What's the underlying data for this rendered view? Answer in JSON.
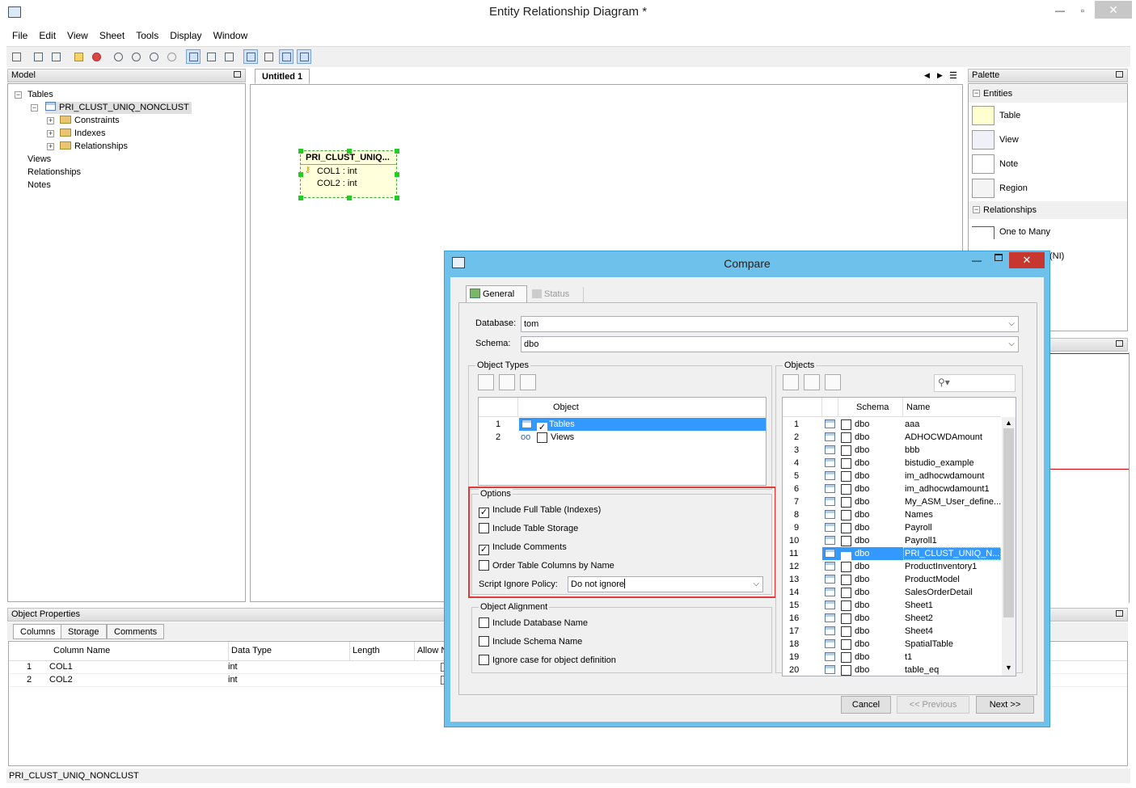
{
  "app": {
    "title": "Entity Relationship Diagram *"
  },
  "menu": [
    "File",
    "Edit",
    "View",
    "Sheet",
    "Tools",
    "Display",
    "Window"
  ],
  "model_panel": {
    "title": "Model",
    "tree": {
      "tables": "Tables",
      "table_name": "PRI_CLUST_UNIQ_NONCLUST",
      "constraints": "Constraints",
      "indexes": "Indexes",
      "relationships_child": "Relationships",
      "views": "Views",
      "relationships": "Relationships",
      "notes": "Notes"
    }
  },
  "sheet": {
    "tab": "Untitled 1",
    "entity": {
      "name": "PRI_CLUST_UNIQ...",
      "col1": "COL1 : int",
      "col2": "COL2 : int"
    }
  },
  "palette": {
    "title": "Palette",
    "entities_header": "Entities",
    "items": [
      "Table",
      "View",
      "Note",
      "Region"
    ],
    "relationships_header": "Relationships",
    "rel_items": [
      "One to Many"
    ],
    "partial_text": "(NI)"
  },
  "object_properties": {
    "title": "Object Properties",
    "tabs": [
      "Columns",
      "Storage",
      "Comments"
    ],
    "headers": [
      "Column Name",
      "Data Type",
      "Length",
      "Allow N"
    ],
    "rows": [
      {
        "n": "1",
        "name": "COL1",
        "type": "int"
      },
      {
        "n": "2",
        "name": "COL2",
        "type": "int"
      }
    ]
  },
  "status_bar": "PRI_CLUST_UNIQ_NONCLUST",
  "dialog": {
    "title": "Compare",
    "tabs": {
      "general": "General",
      "status": "Status"
    },
    "database_label": "Database:",
    "database_value": "tom",
    "schema_label": "Schema:",
    "schema_value": "dbo",
    "object_types": {
      "label": "Object Types",
      "col_header": "Object",
      "rows": [
        {
          "n": "1",
          "name": "Tables",
          "checked": true
        },
        {
          "n": "2",
          "name": "Views",
          "checked": false
        }
      ]
    },
    "options": {
      "label": "Options",
      "include_full_table": "Include Full Table (Indexes)",
      "include_table_storage": "Include Table Storage",
      "include_comments": "Include Comments",
      "order_columns": "Order Table Columns by Name",
      "script_ignore_label": "Script Ignore Policy:",
      "script_ignore_value": "Do not ignore"
    },
    "alignment": {
      "label": "Object Alignment",
      "include_db": "Include Database Name",
      "include_schema": "Include Schema Name",
      "ignore_case": "Ignore case for object definition"
    },
    "objects": {
      "label": "Objects",
      "search_placeholder": "",
      "headers": {
        "schema": "Schema",
        "name": "Name"
      },
      "rows": [
        {
          "n": "1",
          "schema": "dbo",
          "name": "aaa"
        },
        {
          "n": "2",
          "schema": "dbo",
          "name": "ADHOCWDAmount"
        },
        {
          "n": "3",
          "schema": "dbo",
          "name": "bbb"
        },
        {
          "n": "4",
          "schema": "dbo",
          "name": "bistudio_example"
        },
        {
          "n": "5",
          "schema": "dbo",
          "name": "im_adhocwdamount"
        },
        {
          "n": "6",
          "schema": "dbo",
          "name": "im_adhocwdamount1"
        },
        {
          "n": "7",
          "schema": "dbo",
          "name": "My_ASM_User_define..."
        },
        {
          "n": "8",
          "schema": "dbo",
          "name": "Names"
        },
        {
          "n": "9",
          "schema": "dbo",
          "name": "Payroll"
        },
        {
          "n": "10",
          "schema": "dbo",
          "name": "Payroll1"
        },
        {
          "n": "11",
          "schema": "dbo",
          "name": "PRI_CLUST_UNIQ_N..."
        },
        {
          "n": "12",
          "schema": "dbo",
          "name": "ProductInventory1"
        },
        {
          "n": "13",
          "schema": "dbo",
          "name": "ProductModel"
        },
        {
          "n": "14",
          "schema": "dbo",
          "name": "SalesOrderDetail"
        },
        {
          "n": "15",
          "schema": "dbo",
          "name": "Sheet1"
        },
        {
          "n": "16",
          "schema": "dbo",
          "name": "Sheet2"
        },
        {
          "n": "17",
          "schema": "dbo",
          "name": "Sheet4"
        },
        {
          "n": "18",
          "schema": "dbo",
          "name": "SpatialTable"
        },
        {
          "n": "19",
          "schema": "dbo",
          "name": "t1"
        },
        {
          "n": "20",
          "schema": "dbo",
          "name": "table_eq"
        }
      ]
    },
    "buttons": {
      "cancel": "Cancel",
      "previous": "<< Previous",
      "next": "Next >>"
    },
    "colors": {
      "title_bg": "#6ec1ea",
      "selection": "#3399ff",
      "highlight_border": "#e53935"
    }
  }
}
